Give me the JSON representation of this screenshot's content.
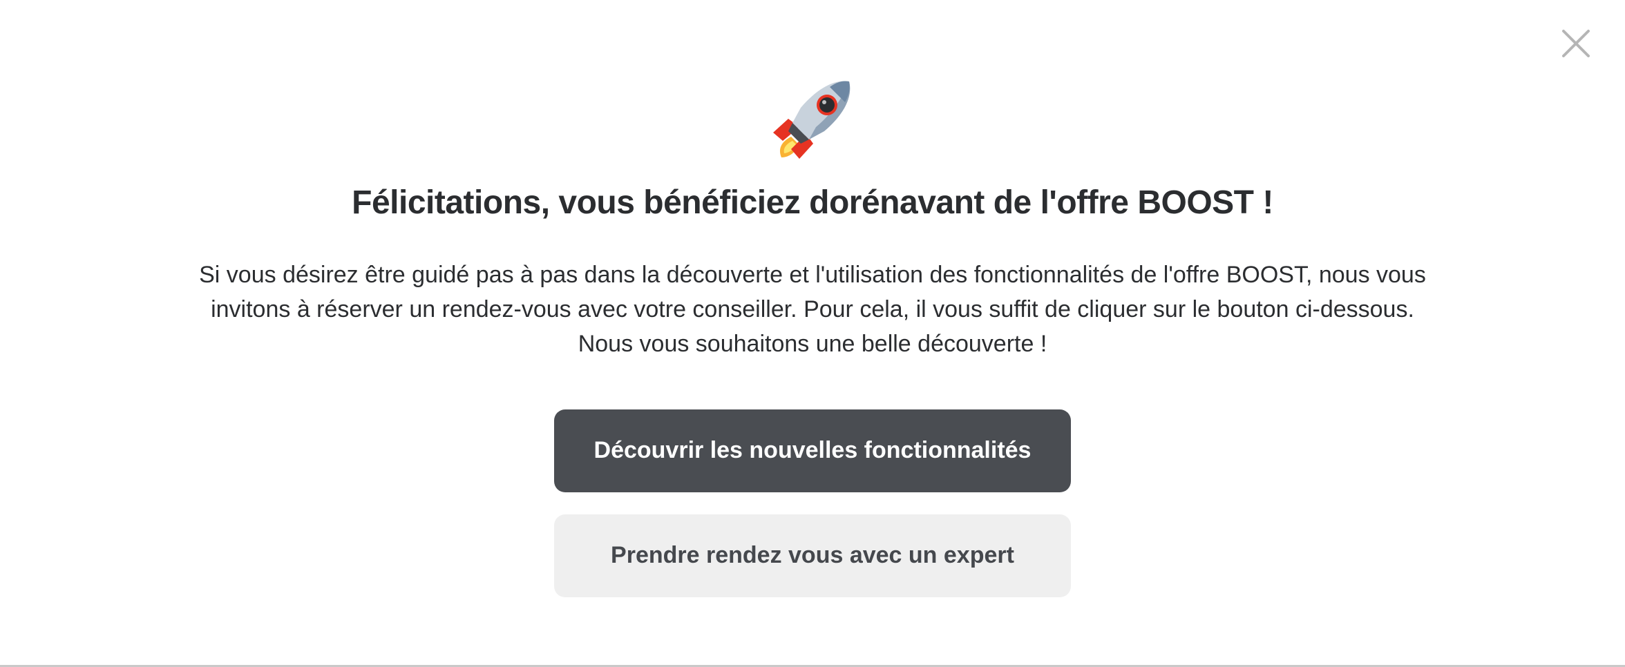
{
  "modal": {
    "close_icon": "close-icon",
    "rocket_icon": "rocket-icon",
    "title": "Félicitations, vous bénéficiez dorénavant de l'offre BOOST !",
    "description_lines": [
      "Si vous désirez être guidé pas à pas dans la découverte et l'utilisation des fonctionnalités de l'offre BOOST, nous vous",
      "invitons à réserver un rendez-vous avec votre conseiller. Pour cela, il vous suffit de cliquer sur le bouton ci-dessous.",
      "Nous vous souhaitons une belle découverte !"
    ],
    "primary_button_label": "Découvrir les nouvelles fonctionnalités",
    "secondary_button_label": "Prendre rendez vous avec un expert"
  },
  "colors": {
    "primary_button_bg": "#4a4d52",
    "secondary_button_bg": "#efefef",
    "text": "#2b2d30",
    "close_icon": "#b5b5b5"
  }
}
